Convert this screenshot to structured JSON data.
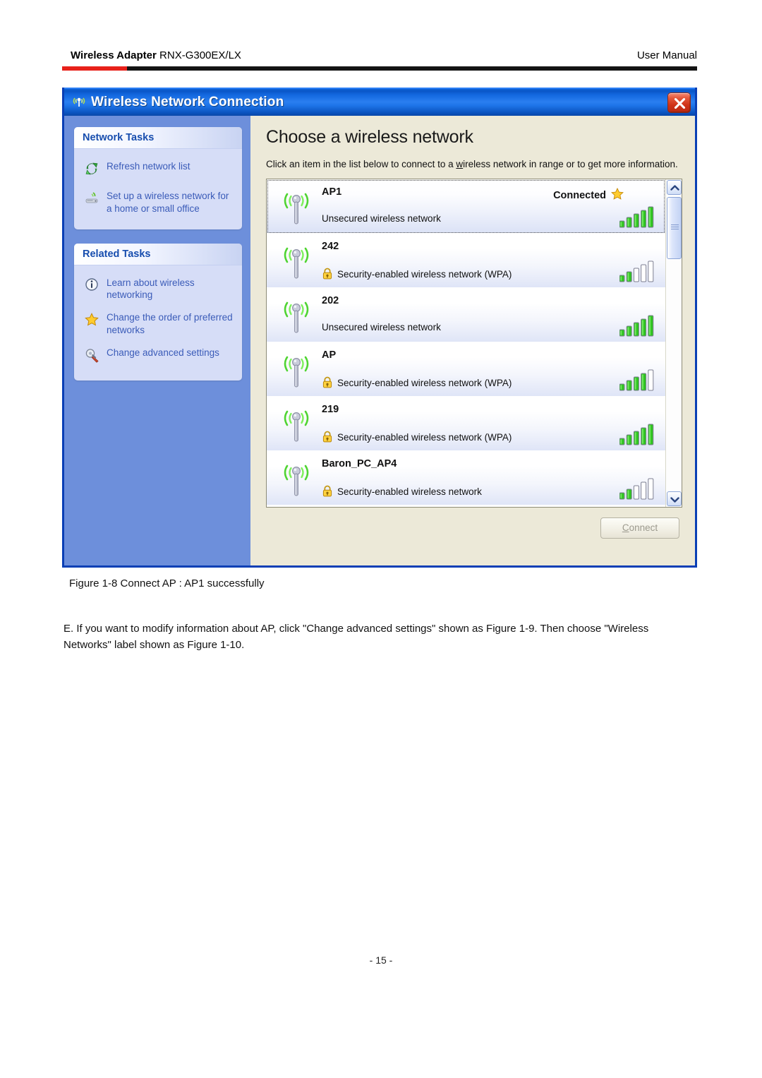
{
  "page": {
    "header": {
      "brand_strong": "Wireless Adapter",
      "brand_model": " RNX-G300EX/LX",
      "right_label": "User Manual",
      "accent_color": "#e8211a"
    },
    "figure_caption": "Figure 1-8 Connect AP : AP1 successfully",
    "body_text": "E. If you want to modify information about AP, click \"Change advanced settings\" shown as Figure 1-9. Then choose \"Wireless Networks\" label shown as Figure 1-10.",
    "page_number": "- 15 -"
  },
  "window": {
    "title": "Wireless Network Connection",
    "title_icon": "wireless-antenna-icon",
    "close_icon": "close-icon",
    "titlebar_color": "#1e74e8",
    "pane_color": "#6d8fdb",
    "content_color": "#ece9d8"
  },
  "taskpane": {
    "panels": [
      {
        "heading": "Network Tasks",
        "tasks": [
          {
            "icon": "refresh-icon",
            "label": "Refresh network list"
          },
          {
            "icon": "setup-wireless-icon",
            "label": "Set up a wireless network for a home or small office"
          }
        ]
      },
      {
        "heading": "Related Tasks",
        "tasks": [
          {
            "icon": "info-icon",
            "label": "Learn about wireless networking"
          },
          {
            "icon": "star-icon",
            "label": "Change the order of preferred networks"
          },
          {
            "icon": "advanced-settings-icon",
            "label": "Change advanced settings"
          }
        ]
      }
    ]
  },
  "content": {
    "title": "Choose a wireless network",
    "instruction_before": "Click an item in the list below to connect to a ",
    "instruction_accel": "w",
    "instruction_after": "ireless network in range or to get more information.",
    "connect_button": {
      "accel": "C",
      "rest": "onnect",
      "enabled": false
    }
  },
  "networks": [
    {
      "ssid": "AP1",
      "status": "Connected",
      "has_star": true,
      "description": "Unsecured wireless network",
      "secured": false,
      "signal_bars": 5,
      "selected": true
    },
    {
      "ssid": "242",
      "status": "",
      "has_star": false,
      "description": "Security-enabled wireless network (WPA)",
      "secured": true,
      "signal_bars": 2,
      "selected": false
    },
    {
      "ssid": "202",
      "status": "",
      "has_star": false,
      "description": "Unsecured wireless network",
      "secured": false,
      "signal_bars": 5,
      "selected": false
    },
    {
      "ssid": "AP",
      "status": "",
      "has_star": false,
      "description": "Security-enabled wireless network (WPA)",
      "secured": true,
      "signal_bars": 4,
      "selected": false
    },
    {
      "ssid": "219",
      "status": "",
      "has_star": false,
      "description": "Security-enabled wireless network (WPA)",
      "secured": true,
      "signal_bars": 5,
      "selected": false
    },
    {
      "ssid": "Baron_PC_AP4",
      "status": "",
      "has_star": false,
      "description": "Security-enabled wireless network",
      "secured": true,
      "signal_bars": 2,
      "selected": false
    }
  ],
  "scrollbar": {
    "up_icon": "chevron-up-icon",
    "down_icon": "chevron-down-icon"
  }
}
